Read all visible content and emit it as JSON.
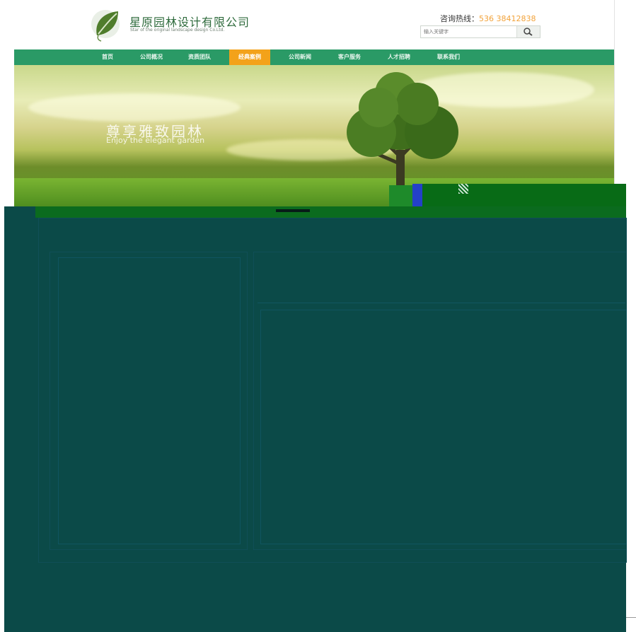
{
  "header": {
    "company_name": "星原园林设计有限公司",
    "company_tagline": "Star of the original landscape design Co.Ltd.",
    "hotline_label": "咨询热线：",
    "hotline_number": "536 38412838",
    "search_placeholder": "输入关键字"
  },
  "nav": {
    "items": [
      {
        "label": "首页",
        "active": false
      },
      {
        "label": "公司概况",
        "active": false
      },
      {
        "label": "资质团队",
        "active": false
      },
      {
        "label": "经典案例",
        "active": true
      },
      {
        "label": "公司新闻",
        "active": false
      },
      {
        "label": "客户服务",
        "active": false
      },
      {
        "label": "人才招聘",
        "active": false
      },
      {
        "label": "联系我们",
        "active": false
      }
    ]
  },
  "banner": {
    "title": "尊享雅致园林",
    "subtitle": "Enjoy the elegant garden"
  },
  "colors": {
    "nav_green": "#2a9a66",
    "nav_active": "#f3a21a",
    "overlay_teal": "#0b4a48",
    "hotline_orange": "#f2a33a"
  },
  "icons": {
    "logo": "leaf-logo-icon",
    "search": "search-icon"
  }
}
